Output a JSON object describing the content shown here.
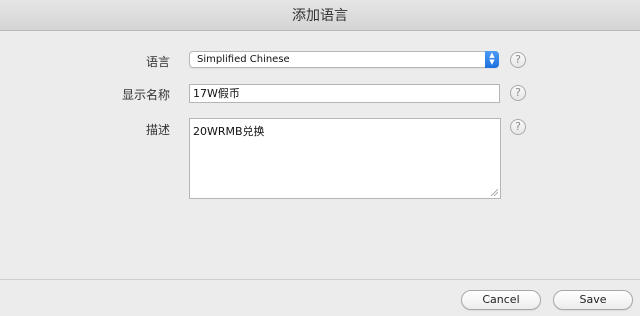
{
  "window": {
    "title": "添加语言"
  },
  "form": {
    "language": {
      "label": "语言",
      "selected": "Simplified Chinese"
    },
    "display_name": {
      "label": "显示名称",
      "value": "17W假币"
    },
    "description": {
      "label": "描述",
      "value": "20WRMB兑换"
    },
    "help_glyph": "?"
  },
  "buttons": {
    "cancel": "Cancel",
    "save": "Save"
  },
  "colors": {
    "accent": "#1d6fe0",
    "background": "#ececec"
  },
  "icons": {
    "help": "question-mark-icon",
    "select_arrows": "up-down-chevron-icon",
    "resize": "resize-grip-icon"
  }
}
